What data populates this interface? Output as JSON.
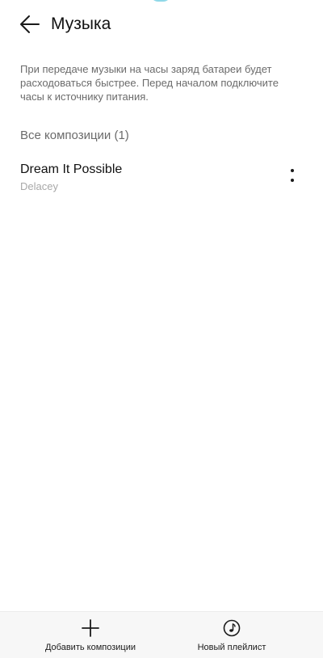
{
  "header": {
    "title": "Музыка",
    "back_icon": "arrow-left-icon"
  },
  "info": {
    "text": "При передаче музыки на часы заряд батареи будет расходоваться быстрее. Перед началом подключите часы к источнику питания."
  },
  "tracks_section": {
    "header": "Все композиции (1)",
    "items": [
      {
        "title": "Dream It Possible",
        "artist": "Delacey",
        "menu_icon": "more-vertical-icon"
      }
    ]
  },
  "bottom_bar": {
    "add_label": "Добавить композиции",
    "add_icon": "plus-icon",
    "playlist_label": "Новый плейлист",
    "playlist_icon": "music-disc-icon"
  },
  "colors": {
    "background": "#ffffff",
    "secondary_text": "#6b6b6b",
    "tertiary_text": "#a8a8a8",
    "bottom_bar": "#f7f7f7",
    "accent": "#8fd8e8"
  }
}
